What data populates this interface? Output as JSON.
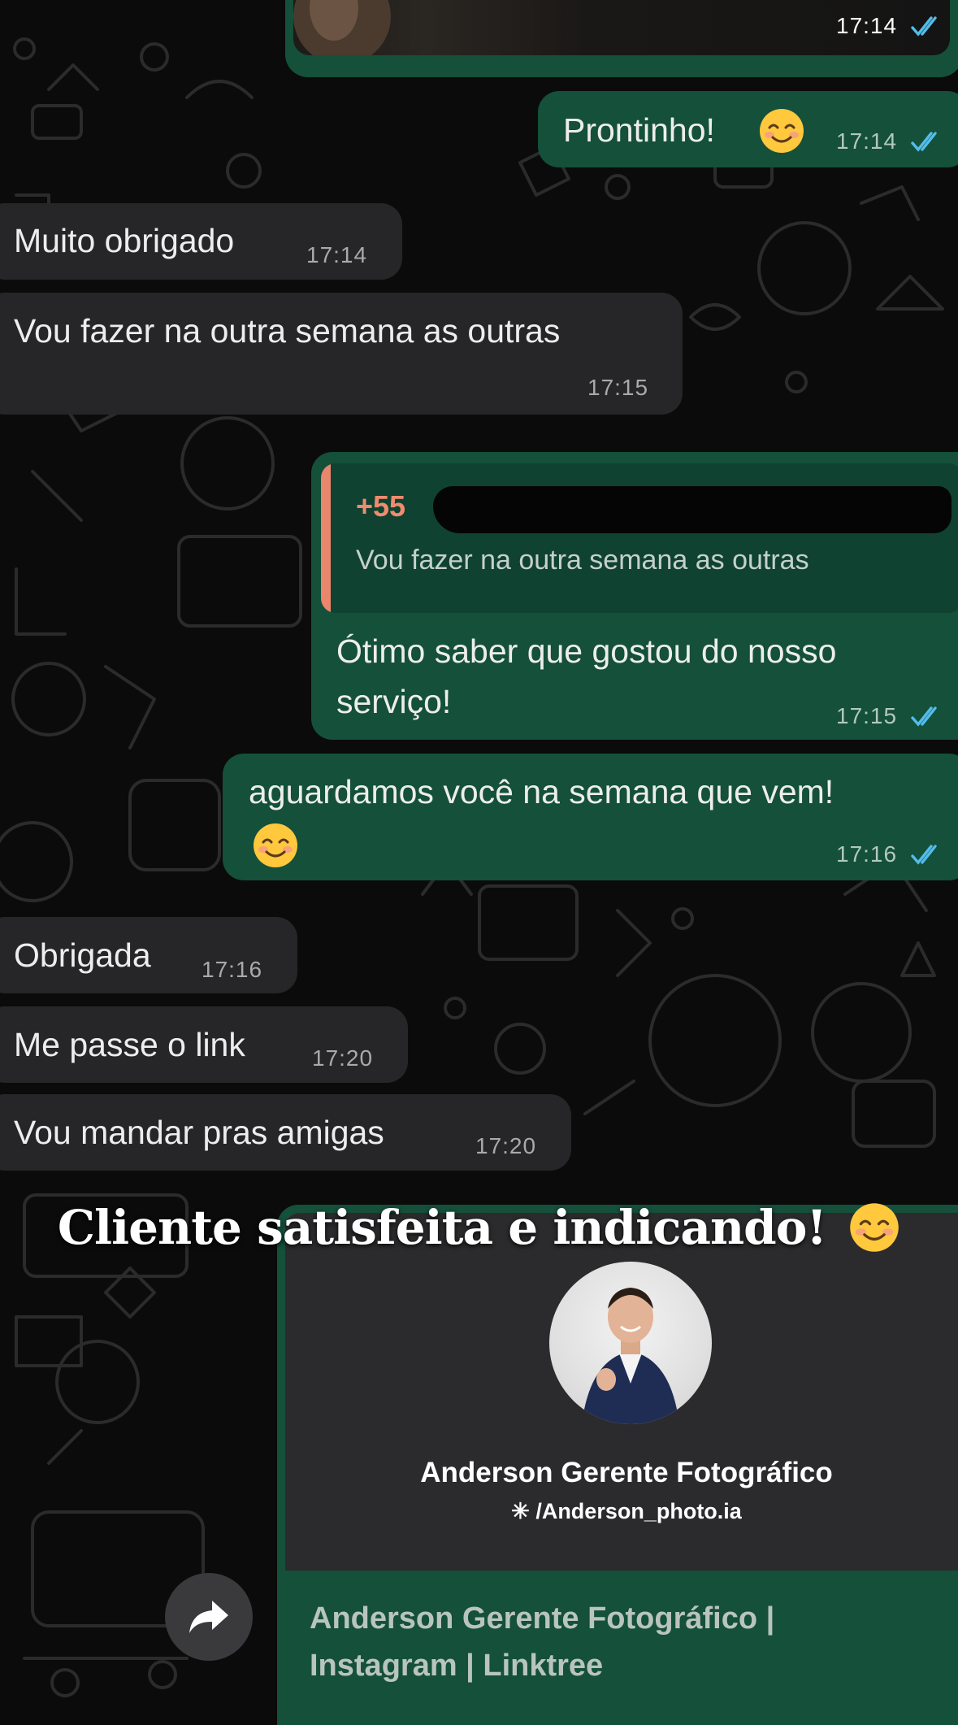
{
  "messages": [
    {
      "id": "m0",
      "direction": "out",
      "kind": "image",
      "time": "17:14",
      "status": "read"
    },
    {
      "id": "m1",
      "direction": "out",
      "text": "Prontinho!",
      "emoji": "smiling-face",
      "time": "17:14",
      "status": "read"
    },
    {
      "id": "m2",
      "direction": "in",
      "text": "Muito obrigado",
      "time": "17:14"
    },
    {
      "id": "m3",
      "direction": "in",
      "text": "Vou fazer na outra semana as outras",
      "time": "17:15"
    },
    {
      "id": "m4",
      "direction": "out",
      "reply_sender": "+55",
      "reply_text": "Vou fazer na outra semana as outras",
      "text_line1": "Ótimo saber que gostou do nosso",
      "text_line2": "serviço!",
      "time": "17:15",
      "status": "read"
    },
    {
      "id": "m5",
      "direction": "out",
      "text": "aguardamos você na semana que vem!",
      "emoji": "smiling-face",
      "time": "17:16",
      "status": "read"
    },
    {
      "id": "m6",
      "direction": "in",
      "text": "Obrigada",
      "time": "17:16"
    },
    {
      "id": "m7",
      "direction": "in",
      "text": "Me passe o link",
      "time": "17:20"
    },
    {
      "id": "m8",
      "direction": "in",
      "text": "Vou mandar pras amigas",
      "time": "17:20"
    }
  ],
  "caption": {
    "text": "Cliente satisfeita e indicando!",
    "emoji": "smiling-face"
  },
  "link_preview": {
    "profile_name": "Anderson Gerente Fotográfico",
    "handle_icon": "asterisk-icon",
    "handle": "/Anderson_photo.ia",
    "title_line1": "Anderson Gerente Fotográfico |",
    "title_line2": "Instagram | Linktree"
  },
  "colors": {
    "background": "#0b0b0b",
    "incoming_bubble": "#262628",
    "outgoing_bubble": "#14503a",
    "read_tick": "#53bdeb",
    "reply_accent": "#e9866c",
    "reply_sender": "#f08b6f"
  },
  "icons": {
    "forward": "forward-icon",
    "read_receipt": "double-check-icon"
  }
}
